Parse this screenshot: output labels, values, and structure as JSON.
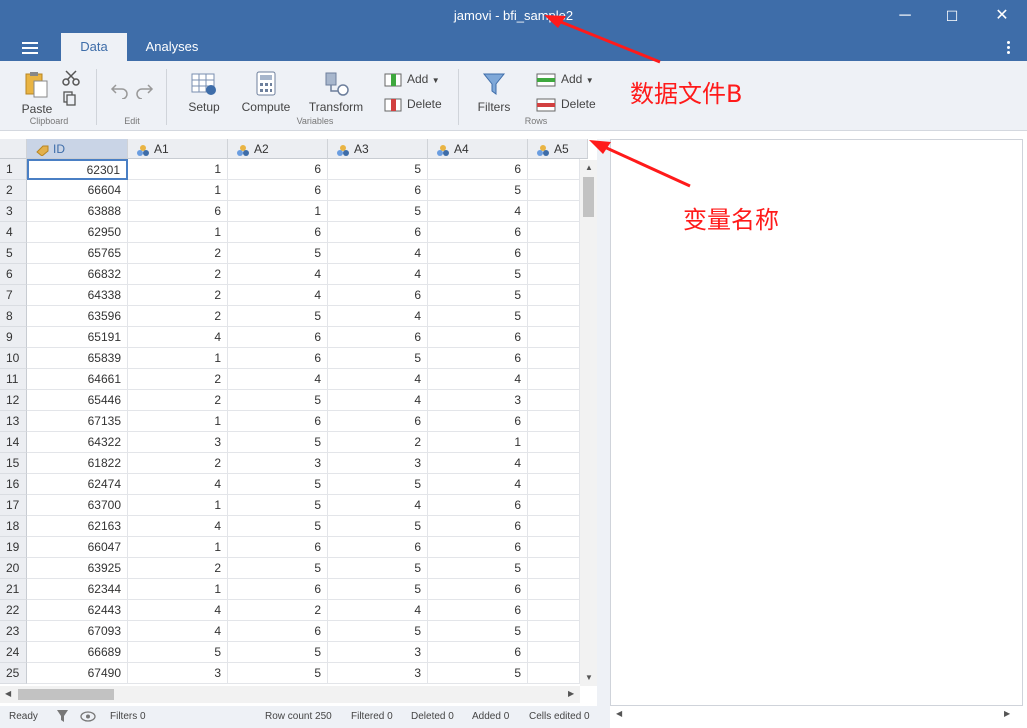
{
  "window": {
    "title": "jamovi - bfi_sample2",
    "minimize": "─",
    "maximize": "☐",
    "close": "✕"
  },
  "tabs": [
    {
      "label": "Data",
      "active": true
    },
    {
      "label": "Analyses",
      "active": false
    }
  ],
  "ribbon": {
    "clipboard": {
      "paste": "Paste",
      "group": "Clipboard"
    },
    "edit": {
      "group": "Edit"
    },
    "variables": {
      "setup": "Setup",
      "compute": "Compute",
      "transform": "Transform",
      "add": "Add",
      "delete": "Delete",
      "group": "Variables"
    },
    "rows": {
      "filters": "Filters",
      "add": "Add",
      "delete": "Delete",
      "group": "Rows"
    }
  },
  "grid": {
    "columns": [
      {
        "name": "ID",
        "type": "id"
      },
      {
        "name": "A1",
        "type": "nominal"
      },
      {
        "name": "A2",
        "type": "nominal"
      },
      {
        "name": "A3",
        "type": "nominal"
      },
      {
        "name": "A4",
        "type": "nominal"
      },
      {
        "name": "A5",
        "type": "nominal"
      }
    ],
    "rows": [
      [
        "62301",
        "1",
        "6",
        "5",
        "6"
      ],
      [
        "66604",
        "1",
        "6",
        "6",
        "5"
      ],
      [
        "63888",
        "6",
        "1",
        "5",
        "4"
      ],
      [
        "62950",
        "1",
        "6",
        "6",
        "6"
      ],
      [
        "65765",
        "2",
        "5",
        "4",
        "6"
      ],
      [
        "66832",
        "2",
        "4",
        "4",
        "5"
      ],
      [
        "64338",
        "2",
        "4",
        "6",
        "5"
      ],
      [
        "63596",
        "2",
        "5",
        "4",
        "5"
      ],
      [
        "65191",
        "4",
        "6",
        "6",
        "6"
      ],
      [
        "65839",
        "1",
        "6",
        "5",
        "6"
      ],
      [
        "64661",
        "2",
        "4",
        "4",
        "4"
      ],
      [
        "65446",
        "2",
        "5",
        "4",
        "3"
      ],
      [
        "67135",
        "1",
        "6",
        "6",
        "6"
      ],
      [
        "64322",
        "3",
        "5",
        "2",
        "1"
      ],
      [
        "61822",
        "2",
        "3",
        "3",
        "4"
      ],
      [
        "62474",
        "4",
        "5",
        "5",
        "4"
      ],
      [
        "63700",
        "1",
        "5",
        "4",
        "6"
      ],
      [
        "62163",
        "4",
        "5",
        "5",
        "6"
      ],
      [
        "66047",
        "1",
        "6",
        "6",
        "6"
      ],
      [
        "63925",
        "2",
        "5",
        "5",
        "5"
      ],
      [
        "62344",
        "1",
        "6",
        "5",
        "6"
      ],
      [
        "62443",
        "4",
        "2",
        "4",
        "6"
      ],
      [
        "67093",
        "4",
        "6",
        "5",
        "5"
      ],
      [
        "66689",
        "5",
        "5",
        "3",
        "6"
      ],
      [
        "67490",
        "3",
        "5",
        "3",
        "5"
      ]
    ]
  },
  "status": {
    "ready": "Ready",
    "filters": "Filters 0",
    "row_count": "Row count 250",
    "filtered": "Filtered 0",
    "deleted": "Deleted 0",
    "added": "Added 0",
    "cells_edited": "Cells edited 0"
  },
  "annotations": {
    "file_label": "数据文件B",
    "variable_label": "变量名称",
    "color": "#ff1a1a"
  },
  "colors": {
    "titlebar": "#3e6da9",
    "ribbon": "#eef1f6",
    "selection": "#4a7fc4"
  }
}
